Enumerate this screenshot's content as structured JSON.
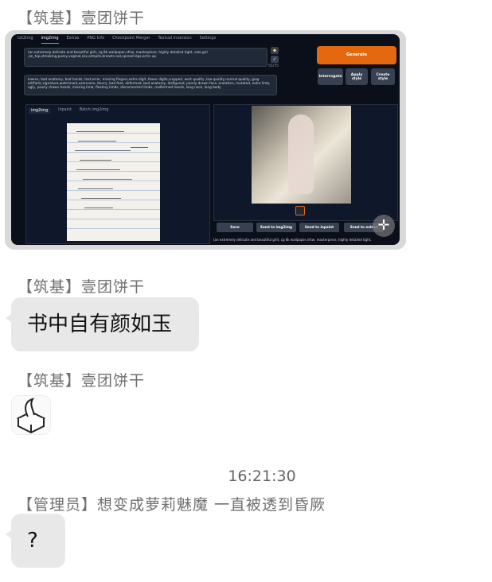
{
  "messages": [
    {
      "sender": "【筑基】壹团饼干",
      "type": "image"
    },
    {
      "sender": "【筑基】壹团饼干",
      "type": "text",
      "text": "书中自有颜如玉"
    },
    {
      "sender": "【筑基】壹团饼干",
      "type": "sticker",
      "icon": "tissue-box-icon"
    },
    {
      "timestamp": "16:21:30"
    },
    {
      "sender": "【管理员】想变成萝莉魅魔 一直被透到昏厥",
      "type": "text",
      "text": "?"
    }
  ],
  "screenshot": {
    "tabs": [
      "txt2img",
      "img2img",
      "Extras",
      "PNG Info",
      "Checkpoint Merger",
      "Textual inversion",
      "Settings"
    ],
    "active_tab": "img2img",
    "prompt": "(an extremely delicate and beautiful girl), cg 8k wallpaper,nfsw, masterpiece, highly detailed tight, solo,girl ,on_top,streaking,pussy,vaginal,sex,armpits,breasts out,spread legs,arms up",
    "negative_prompt": "lowres, bad anatomy, bad hands, text,error, missing fingers,extra digit ,fewer digits,cropped, wort quality ,low quality,normal quality, jpeg artifacts,signature,watermark,username, blurry, bad feet, deformed, bad anatomy, disfigured, poorly drawn face, mutation, mutated, extra limb, ugly, poorly drawn hands, missing limb, floating limbs, disconnected limbs, malformed hands, long neck, long body",
    "token_count": "55/75",
    "generate_label": "Generate",
    "interrogate_label": "Interrogate",
    "apply_style_label": "Apply style",
    "create_style_label": "Create style",
    "subtabs": [
      "img2img",
      "Inpaint",
      "Batch img2img"
    ],
    "active_subtab": "img2img",
    "actions": [
      "Save",
      "Send to img2img",
      "Send to inpaint",
      "Send to extras"
    ],
    "output_caption": "(an extremely delicate and beautiful girl), cg 8k wallpaper,nfsw, masterpiece, highly detailed tight,",
    "accent_color": "#e4680f"
  }
}
